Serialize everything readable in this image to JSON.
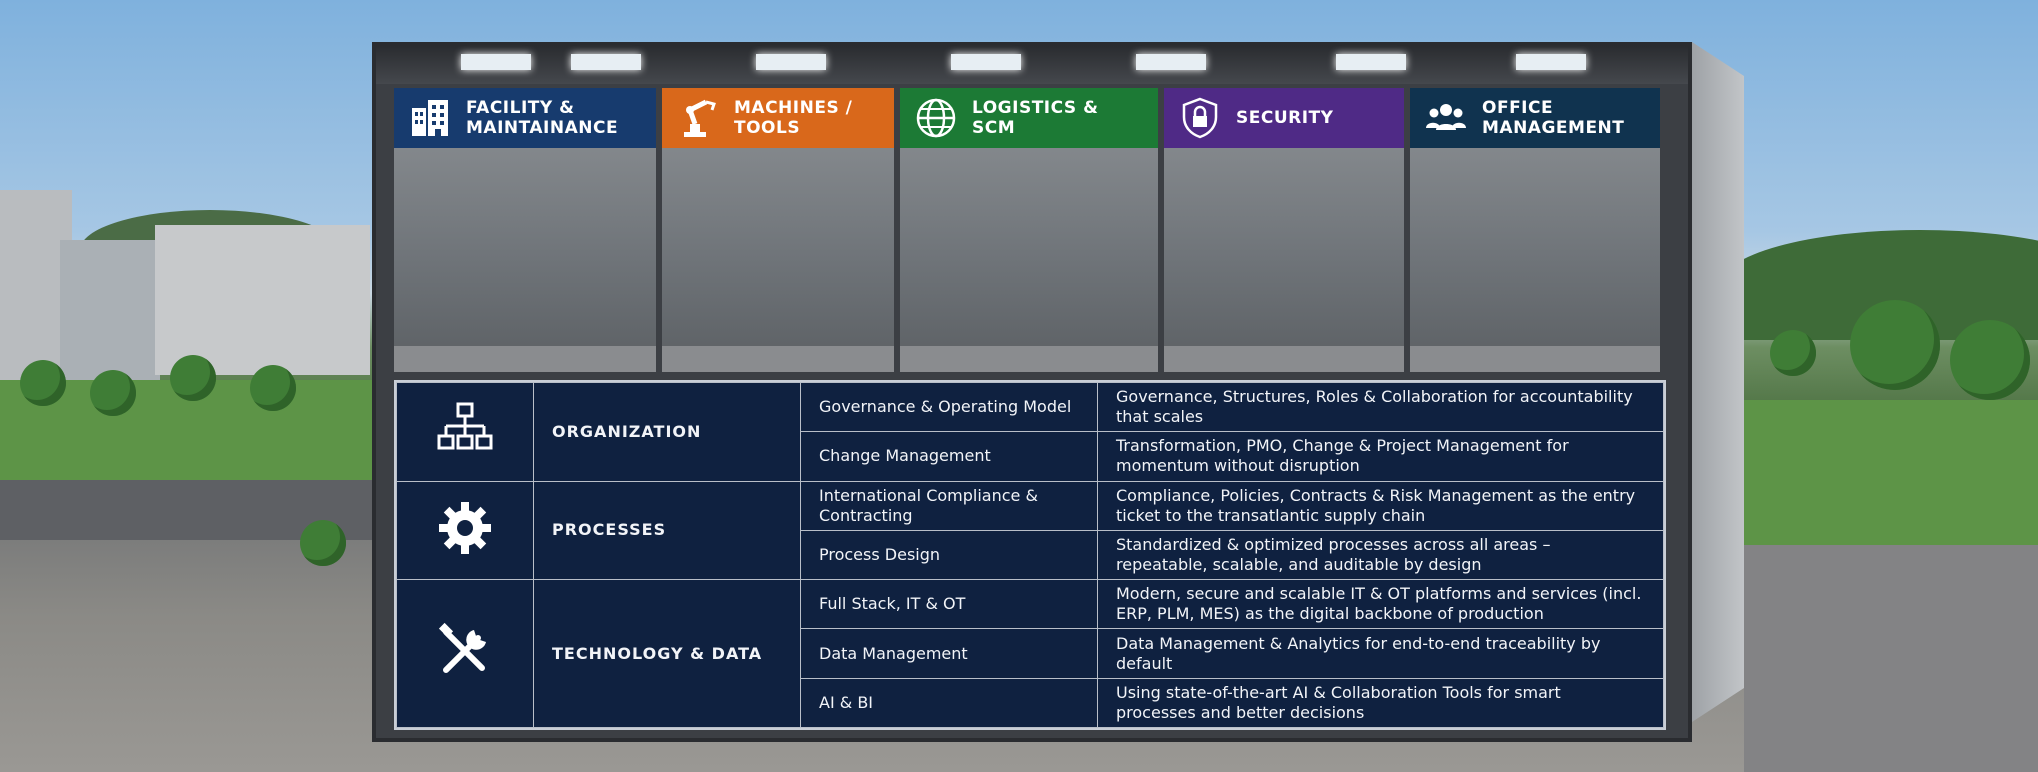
{
  "colors": {
    "facility": "#173b6e",
    "machines": "#d9681b",
    "logistics": "#1c7a35",
    "security": "#4f2a86",
    "office": "#10334f",
    "table_bg": "#0f2140"
  },
  "bays": [
    {
      "icon": "building-icon",
      "label": "FACILITY &\nMAINTAINANCE"
    },
    {
      "icon": "robot-arm-icon",
      "label": "MACHINES /\nTOOLS"
    },
    {
      "icon": "globe-icon",
      "label": "LOGISTICS & SCM"
    },
    {
      "icon": "shield-lock-icon",
      "label": "SECURITY"
    },
    {
      "icon": "people-icon",
      "label": "OFFICE\nMANAGEMENT"
    }
  ],
  "categories": [
    {
      "icon": "org-chart-icon",
      "name": "ORGANIZATION",
      "rows": [
        {
          "topic": "Governance & Operating Model",
          "desc": "Governance, Structures, Roles & Collaboration for accountability that scales"
        },
        {
          "topic": "Change Management",
          "desc": "Transformation, PMO, Change & Project Management for momentum without disruption"
        }
      ]
    },
    {
      "icon": "gear-icon",
      "name": "PROCESSES",
      "rows": [
        {
          "topic": "International Compliance & Contracting",
          "desc": "Compliance, Policies, Contracts & Risk Management as the entry ticket to the transatlantic supply chain"
        },
        {
          "topic": "Process Design",
          "desc": "Standardized & optimized processes across all areas – repeatable, scalable, and auditable by design"
        }
      ]
    },
    {
      "icon": "tools-icon",
      "name": "TECHNOLOGY & DATA",
      "rows": [
        {
          "topic": "Full Stack, IT & OT",
          "desc": "Modern, secure and scalable IT & OT platforms and services (incl. ERP, PLM, MES) as the digital backbone of production"
        },
        {
          "topic": "Data Management",
          "desc": "Data Management & Analytics for end-to-end traceability by default"
        },
        {
          "topic": "AI & BI",
          "desc": "Using state-of-the-art AI & Collaboration Tools for smart processes and better decisions"
        }
      ]
    }
  ]
}
